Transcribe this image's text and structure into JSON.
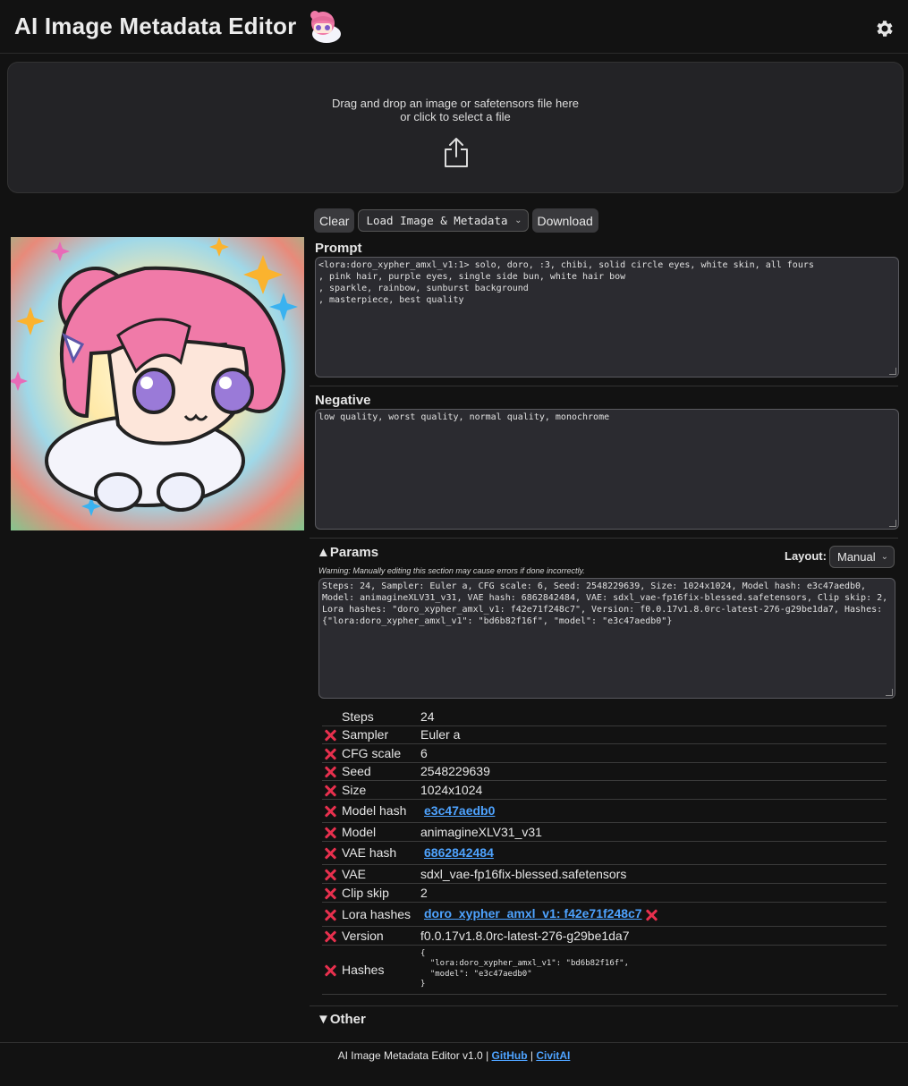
{
  "header": {
    "title": "AI Image Metadata Editor"
  },
  "dropzone": {
    "line1": "Drag and drop an image or safetensors file here",
    "line2": "or click to select a file"
  },
  "toolbar": {
    "clear": "Clear",
    "load_select": "Load Image & Metadata",
    "download": "Download"
  },
  "prompt": {
    "label": "Prompt",
    "value": "<lora:doro_xypher_amxl_v1:1> solo, doro, :3, chibi, solid circle eyes, white skin, all fours\n, pink hair, purple eyes, single side bun, white hair bow\n, sparkle, rainbow, sunburst background\n, masterpiece, best quality"
  },
  "negative": {
    "label": "Negative",
    "value": "low quality, worst quality, normal quality, monochrome"
  },
  "params": {
    "label": "▲Params",
    "layout_label": "Layout:",
    "layout_value": "Manual",
    "warning": "Warning: Manually editing this section may cause errors if done incorrectly.",
    "raw": "Steps: 24, Sampler: Euler a, CFG scale: 6, Seed: 2548229639, Size: 1024x1024, Model hash: e3c47aedb0, Model: animagineXLV31_v31, VAE hash: 6862842484, VAE: sdxl_vae-fp16fix-blessed.safetensors, Clip skip: 2, Lora hashes: \"doro_xypher_amxl_v1: f42e71f248c7\", Version: f0.0.17v1.8.0rc-latest-276-g29be1da7, Hashes: {\"lora:doro_xypher_amxl_v1\": \"bd6b82f16f\", \"model\": \"e3c47aedb0\"}",
    "rows": [
      {
        "key": "Steps",
        "value": "24"
      },
      {
        "key": "Sampler",
        "value": "Euler a"
      },
      {
        "key": "CFG scale",
        "value": "6"
      },
      {
        "key": "Seed",
        "value": "2548229639"
      },
      {
        "key": "Size",
        "value": "1024x1024"
      },
      {
        "key": "Model hash",
        "value": "e3c47aedb0"
      },
      {
        "key": "Model",
        "value": "animagineXLV31_v31"
      },
      {
        "key": "VAE hash",
        "value": "6862842484"
      },
      {
        "key": "VAE",
        "value": "sdxl_vae-fp16fix-blessed.safetensors"
      },
      {
        "key": "Clip skip",
        "value": "2"
      },
      {
        "key": "Lora hashes",
        "value": "doro_xypher_amxl_v1: f42e71f248c7"
      },
      {
        "key": "Version",
        "value": "f0.0.17v1.8.0rc-latest-276-g29be1da7"
      },
      {
        "key": "Hashes",
        "value": "{\n  \"lora:doro_xypher_amxl_v1\": \"bd6b82f16f\",\n  \"model\": \"e3c47aedb0\"\n}"
      }
    ]
  },
  "other": {
    "label": "▼Other"
  },
  "footer": {
    "text": "AI Image Metadata Editor v1.0",
    "sep": "|",
    "github": "GitHub",
    "civitai": "CivitAI"
  },
  "colors": {
    "background": "#121212",
    "panel": "#232326",
    "link": "#4ea3ff",
    "remove": "#e8304e"
  },
  "icons": [
    "gear-icon",
    "upload-icon",
    "remove-icon",
    "chevron-down-icon"
  ]
}
